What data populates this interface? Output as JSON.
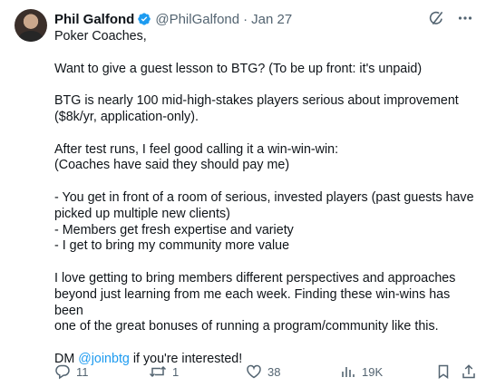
{
  "author": {
    "name": "Phil Galfond",
    "handle": "@PhilGalfond",
    "separator": "·",
    "date": "Jan 27"
  },
  "post": {
    "greeting": "Poker Coaches,",
    "line_question": "Want to give a guest lesson to BTG? (To be up front: it's unpaid)",
    "line_btg_1": "BTG is nearly 100 mid-high-stakes players serious about improvement",
    "line_btg_2": "($8k/yr, application-only).",
    "line_after_1": "After test runs, I feel good calling it a win-win-win:",
    "line_after_2": "(Coaches have said they should pay me)",
    "line_b1_1": "- You get in front of a room of serious, invested players (past guests have",
    "line_b1_2": "picked up multiple new clients)",
    "line_b2": "- Members get fresh expertise and variety",
    "line_b3": "- I get to bring my community more value",
    "line_love_1": "I love getting to bring members different perspectives and approaches",
    "line_love_2": "beyond just learning from me each week. Finding these win-wins has been",
    "line_love_3": "one of the great bonuses of running a program/community like this.",
    "dm_prefix": "DM ",
    "dm_mention": "@joinbtg",
    "dm_suffix": " if you're interested!"
  },
  "actions": {
    "replies": "11",
    "reposts": "1",
    "likes": "38",
    "views": "19K"
  },
  "icons": {
    "verified": "verified-badge-icon",
    "grok": "grok-icon",
    "more": "more-icon",
    "reply": "reply-icon",
    "repost": "repost-icon",
    "like": "like-icon",
    "views": "views-icon",
    "bookmark": "bookmark-icon",
    "share": "share-icon"
  },
  "colors": {
    "text": "#0f1419",
    "secondary": "#536471",
    "accent": "#1d9bf0"
  }
}
